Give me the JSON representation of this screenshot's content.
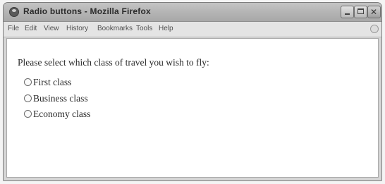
{
  "window": {
    "title": "Radio buttons - Mozilla Firefox",
    "app_icon": "firefox-icon",
    "controls": {
      "minimize_icon": "minimize-icon",
      "maximize_icon": "maximize-icon",
      "close_icon": "close-icon"
    }
  },
  "menubar": {
    "items": [
      {
        "label": "File"
      },
      {
        "label": "Edit"
      },
      {
        "label": "View"
      },
      {
        "label": "History"
      },
      {
        "label": "Bookmarks"
      },
      {
        "label": "Tools"
      },
      {
        "label": "Help"
      }
    ],
    "throbber_icon": "throbber-icon"
  },
  "page": {
    "prompt": "Please select which class of travel you wish to fly:",
    "options": [
      {
        "label": "First class",
        "selected": false
      },
      {
        "label": "Business class",
        "selected": false
      },
      {
        "label": "Economy class",
        "selected": false
      }
    ]
  }
}
